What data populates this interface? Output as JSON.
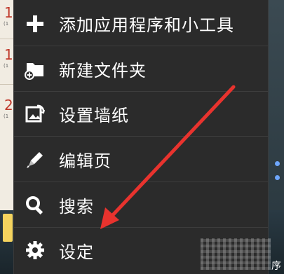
{
  "background": {
    "dates": [
      {
        "day": "1",
        "sub": "(1"
      },
      {
        "day": "1",
        "sub": "(1"
      },
      {
        "day": "2",
        "sub": "(1"
      }
    ],
    "right_text": "序"
  },
  "menu": {
    "items": [
      {
        "label": "添加应用程序和小工具",
        "icon": "plus-icon"
      },
      {
        "label": "新建文件夹",
        "icon": "new-folder-icon"
      },
      {
        "label": "设置墙纸",
        "icon": "wallpaper-icon"
      },
      {
        "label": "编辑页",
        "icon": "pencil-icon"
      },
      {
        "label": "搜索",
        "icon": "search-icon"
      },
      {
        "label": "设定",
        "icon": "gear-icon"
      }
    ]
  },
  "annotation": {
    "arrow_color": "#e8332e",
    "points_to": "设定"
  },
  "colors": {
    "menu_bg": "#2b2b2b",
    "text": "#ffffff",
    "accent": "#e8332e"
  }
}
